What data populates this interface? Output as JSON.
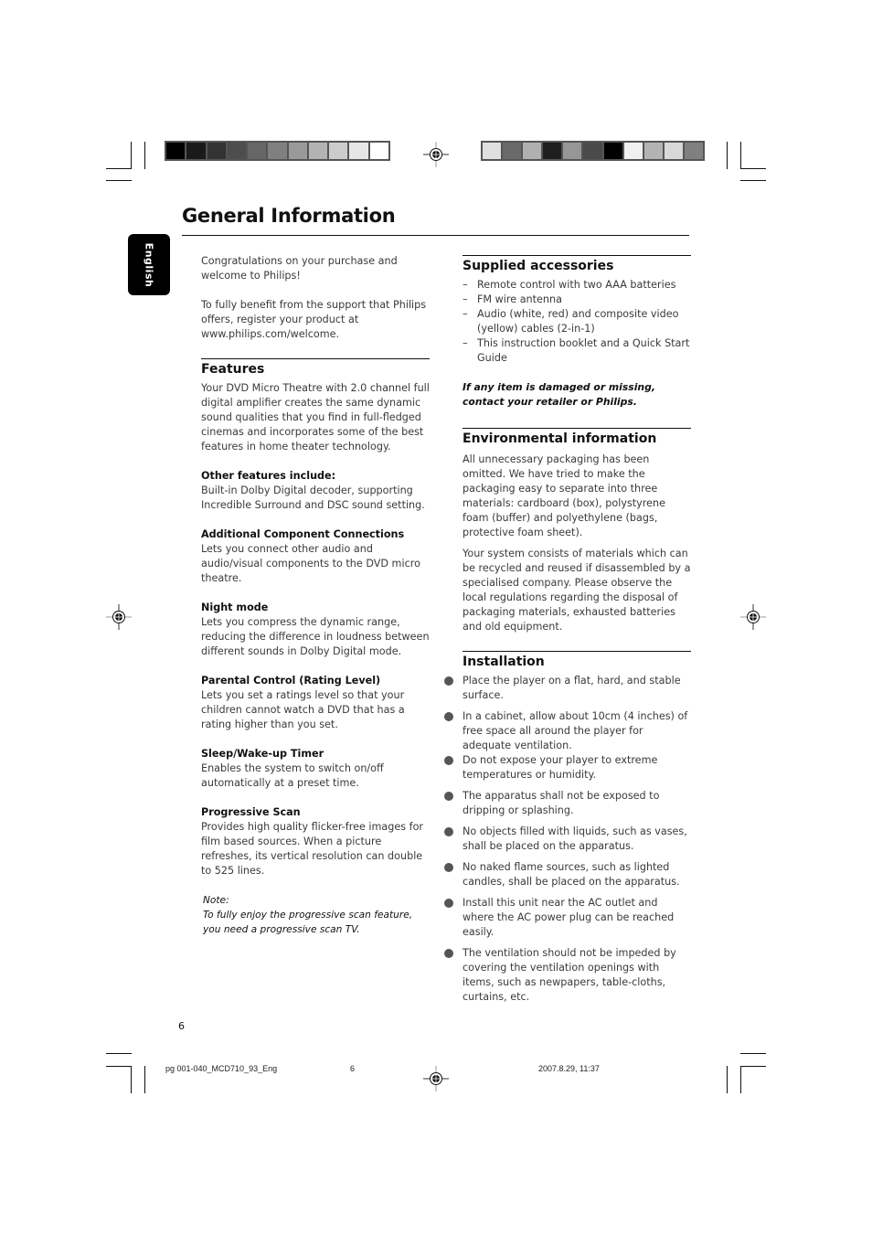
{
  "page": {
    "title": "General Information",
    "language_tab": "English",
    "page_number": "6"
  },
  "color_bars": {
    "left": [
      "#000000",
      "#1a1a1a",
      "#333333",
      "#4d4d4d",
      "#666666",
      "#808080",
      "#999999",
      "#b3b3b3",
      "#cccccc",
      "#e6e6e6",
      "#ffffff"
    ],
    "right": [
      "#e0e0e0",
      "#6a6a6a",
      "#b0b0b0",
      "#1e1e1e",
      "#969696",
      "#4a4a4a",
      "#000000",
      "#f0f0f0",
      "#b3b3b3",
      "#d8d8d8",
      "#808080"
    ]
  },
  "intro": {
    "p1": "Congratulations on your purchase and welcome to Philips!",
    "p2": "To fully benefit from the support that Philips offers, register your product at www.philips.com/welcome."
  },
  "features": {
    "heading": "Features",
    "body": "Your DVD Micro Theatre with 2.0 channel full digital amplifier creates the same dynamic sound qualities that you find in full-fledged cinemas and incorporates some of the best features in home theater technology.",
    "items": [
      {
        "title": "Other features include:",
        "text": "Built-in Dolby Digital decoder, supporting Incredible Surround and DSC sound setting."
      },
      {
        "title": "Additional Component Connections",
        "text": "Lets you connect other audio and audio/visual components to the DVD micro theatre."
      },
      {
        "title": "Night mode",
        "text": "Lets you compress the dynamic range, reducing the difference in loudness between different sounds in Dolby Digital mode."
      },
      {
        "title": "Parental Control (Rating Level)",
        "text": "Lets you set a ratings level so that your children cannot watch a DVD that has a rating higher than you set."
      },
      {
        "title": "Sleep/Wake-up Timer",
        "text": "Enables the system to switch on/off automatically at a preset time."
      },
      {
        "title": "Progressive Scan",
        "text": "Provides high quality flicker-free images for film based sources. When a picture refreshes, its vertical resolution can double to 525 lines."
      }
    ],
    "note_label": "Note:",
    "note_text": "To fully enjoy the progressive scan feature, you need a progressive scan TV."
  },
  "accessories": {
    "heading": "Supplied accessories",
    "dash": "–",
    "items": [
      "Remote control with two AAA batteries",
      "FM wire antenna",
      "Audio (white, red) and composite video (yellow) cables (2-in-1)",
      "This instruction booklet and a Quick Start Guide"
    ],
    "warning": "If any item is damaged or missing, contact your retailer or Philips."
  },
  "environment": {
    "heading": "Environmental information",
    "p1": "All unnecessary packaging has been omitted. We have tried to make the packaging easy to separate into three materials: cardboard (box), polystyrene foam (buffer) and polyethylene (bags, protective foam sheet).",
    "p2": "Your system consists of materials which can be recycled and reused if disassembled by a specialised company. Please observe the local regulations regarding the disposal of packaging materials, exhausted batteries and old equipment."
  },
  "installation": {
    "heading": "Installation",
    "items": [
      "Place the player on a flat, hard, and stable surface.",
      "In a cabinet, allow about 10cm (4 inches) of free space all around the player for adequate ventilation.",
      "Do not expose your player to extreme temperatures or humidity.",
      "The apparatus shall not be exposed to dripping or splashing.",
      "No objects  filled with liquids, such as vases, shall be placed on the apparatus.",
      "No naked flame sources, such as lighted candles, shall be placed on the apparatus.",
      "Install this unit near the AC outlet and where the AC power plug can be reached easily.",
      "The ventilation should not be impeded by covering the ventilation openings with items, such as newpapers, table-cloths, curtains, etc."
    ]
  },
  "print_footer": {
    "file": "pg 001-040_MCD710_93_Eng",
    "page": "6",
    "timestamp": "2007.8.29, 11:37"
  }
}
